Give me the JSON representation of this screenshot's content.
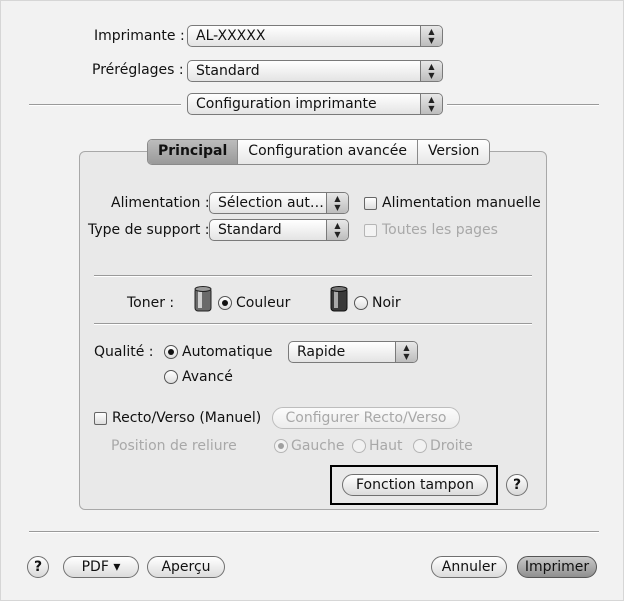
{
  "printer": {
    "label": "Imprimante :",
    "value": "AL-XXXXX"
  },
  "presets": {
    "label": "Préréglages :",
    "value": "Standard"
  },
  "panel_select": {
    "value": "Configuration imprimante"
  },
  "tabs": [
    {
      "label": "Principal",
      "active": true
    },
    {
      "label": "Configuration avancée",
      "active": false
    },
    {
      "label": "Version",
      "active": false
    }
  ],
  "paper_source": {
    "label": "Alimentation :",
    "value": "Sélection aut…",
    "manual_label": "Alimentation manuelle"
  },
  "media_type": {
    "label": "Type de support :",
    "value": "Standard",
    "all_pages_label": "Toutes les pages"
  },
  "toner": {
    "label": "Toner :",
    "color_label": "Couleur",
    "black_label": "Noir",
    "selected": "Couleur"
  },
  "quality": {
    "label": "Qualité :",
    "auto_label": "Automatique",
    "auto_value": "Rapide",
    "advanced_label": "Avancé",
    "selected": "Automatique"
  },
  "duplex": {
    "label": "Recto/Verso (Manuel)",
    "configure_label": "Configurer Recto/Verso",
    "binding_label": "Position de reliure",
    "left_label": "Gauche",
    "top_label": "Haut",
    "right_label": "Droite",
    "selected": "Gauche"
  },
  "stamp_button": {
    "label": "Fonction tampon"
  },
  "help_symbol": "?",
  "bottom": {
    "pdf_label": "PDF ▾",
    "preview_label": "Aperçu",
    "cancel_label": "Annuler",
    "print_label": "Imprimer"
  },
  "arrows_symbol": "▲▼",
  "colors": {
    "highlight_border": "#000000",
    "default_button": "#9a9a9a"
  }
}
